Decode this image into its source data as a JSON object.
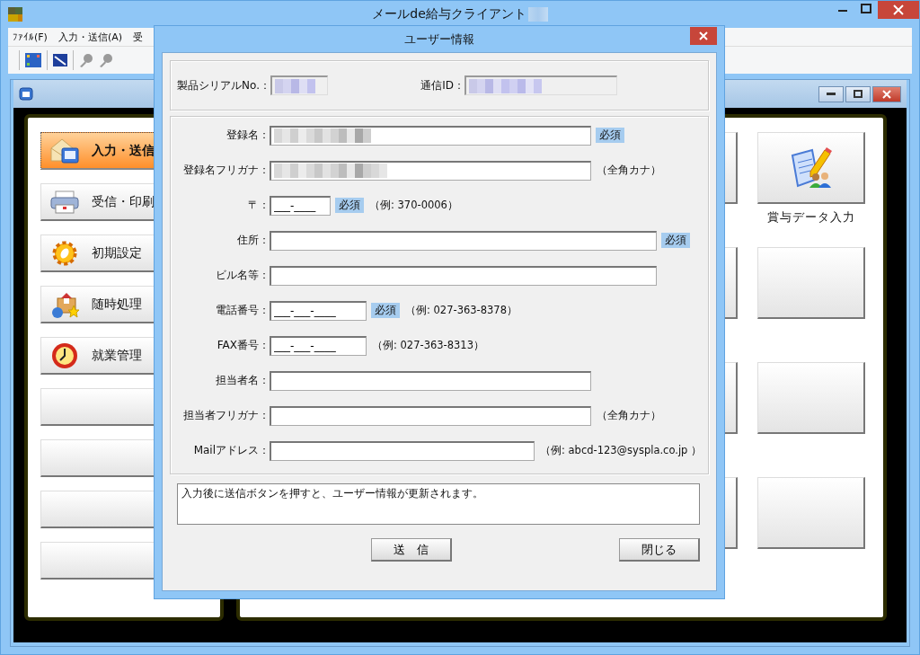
{
  "window": {
    "title": "メールde給与クライアント",
    "title_redacted": true
  },
  "menu": [
    "ﾌｧｲﾙ(F)",
    "入力・送信(A)",
    "受"
  ],
  "sidebar": {
    "items": [
      {
        "label": "入力・送信",
        "kind": "send",
        "selected": true
      },
      {
        "label": "受信・印刷",
        "kind": "print",
        "selected": false
      },
      {
        "label": "初期設定",
        "kind": "settings",
        "selected": false
      },
      {
        "label": "随時処理",
        "kind": "process",
        "selected": false
      },
      {
        "label": "就業管理",
        "kind": "attendance",
        "selected": false
      },
      {
        "kind": "empty",
        "selected": false
      },
      {
        "kind": "empty",
        "selected": false
      },
      {
        "kind": "empty",
        "selected": false
      },
      {
        "kind": "empty",
        "selected": false
      }
    ]
  },
  "tiles": [
    {
      "kind": "empty"
    },
    {
      "kind": "bonus",
      "label": "賞与データ入力"
    },
    {
      "kind": "empty"
    },
    {
      "kind": "empty"
    },
    {
      "kind": "empty"
    },
    {
      "kind": "empty"
    },
    {
      "kind": "empty"
    },
    {
      "kind": "empty"
    }
  ],
  "dialog": {
    "title": "ユーザー情報",
    "header": [
      {
        "label": "製品シリアルNo.：",
        "kind": "serial",
        "redacted": true
      },
      {
        "label": "通信ID：",
        "kind": "commid",
        "redacted": true
      }
    ],
    "fields": [
      {
        "label": "登録名：",
        "kind": "name",
        "redacted": true,
        "badge": "必須"
      },
      {
        "label": "登録名フリガナ：",
        "kind": "name",
        "redacted": true,
        "note": "（全角カナ）"
      },
      {
        "label": "〒：",
        "kind": "postal",
        "value": "___-____",
        "redacted": false,
        "badge": "必須",
        "note": "（例: 370-0006）"
      },
      {
        "label": "住所：",
        "kind": "address",
        "redacted": false,
        "badge": "必須"
      },
      {
        "label": "ビル名等：",
        "kind": "address",
        "redacted": false
      },
      {
        "label": "電話番号：",
        "kind": "phone",
        "value": "___-___-____",
        "redacted": false,
        "badge": "必須",
        "note": "（例: 027-363-8378）"
      },
      {
        "label": "FAX番号：",
        "kind": "phone",
        "value": "___-___-____",
        "redacted": false,
        "note": "（例: 027-363-8313）"
      },
      {
        "label": "担当者名：",
        "kind": "name",
        "redacted": false
      },
      {
        "label": "担当者フリガナ：",
        "kind": "name",
        "redacted": false,
        "note": "（全角カナ）"
      },
      {
        "label": "Mailアドレス：",
        "kind": "mail",
        "redacted": false,
        "note": "（例: abcd-123@syspla.co.jp ）"
      }
    ],
    "message": "入力後に送信ボタンを押すと、ユーザー情報が更新されます。",
    "buttons": [
      "送　信",
      "閉じる"
    ]
  }
}
